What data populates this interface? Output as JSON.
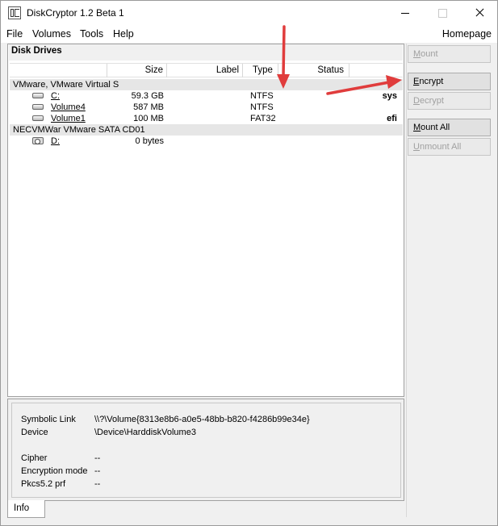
{
  "window": {
    "title": "DiskCryptor 1.2 Beta 1"
  },
  "menu": {
    "items": [
      "File",
      "Volumes",
      "Tools",
      "Help"
    ],
    "homepage": "Homepage"
  },
  "disk_drives": {
    "title": "Disk Drives",
    "columns": [
      "",
      "Size",
      "Label",
      "Type",
      "Status",
      ""
    ],
    "groups": [
      {
        "name": "VMware, VMware Virtual S",
        "volumes": [
          {
            "name": "C:",
            "size": "59.3 GB",
            "label": "",
            "type": "NTFS",
            "status": "",
            "flag": "sys"
          },
          {
            "name": "Volume4",
            "size": "587 MB",
            "label": "",
            "type": "NTFS",
            "status": "",
            "flag": ""
          },
          {
            "name": "Volume1",
            "size": "100 MB",
            "label": "",
            "type": "FAT32",
            "status": "",
            "flag": "efi"
          }
        ]
      },
      {
        "name": "NECVMWar VMware SATA CD01",
        "volumes": [
          {
            "name": "D:",
            "size": "0 bytes",
            "label": "",
            "type": "",
            "status": "",
            "flag": ""
          }
        ]
      }
    ]
  },
  "info": {
    "rows": [
      {
        "label": "Symbolic Link",
        "value": "\\\\?\\Volume{8313e8b6-a0e5-48bb-b820-f4286b99e34e}"
      },
      {
        "label": "Device",
        "value": "\\Device\\HarddiskVolume3"
      },
      {
        "label": "Cipher",
        "value": "--"
      },
      {
        "label": "Encryption mode",
        "value": "--"
      },
      {
        "label": "Pkcs5.2 prf",
        "value": "--"
      }
    ],
    "tab": "Info"
  },
  "side_buttons": {
    "mount": {
      "first": "M",
      "rest": "ount"
    },
    "encrypt": {
      "first": "E",
      "rest": "ncrypt"
    },
    "decrypt": {
      "first": "D",
      "rest": "ecrypt"
    },
    "mount_all": {
      "first": "M",
      "rest": "ount All"
    },
    "unmount_all": {
      "first": "U",
      "rest": "nmount All"
    }
  },
  "colors": {
    "annotation_arrow": "#e03c3c",
    "group_row_bg": "#e6e6e6",
    "window_bg": "#f0f0f0"
  }
}
